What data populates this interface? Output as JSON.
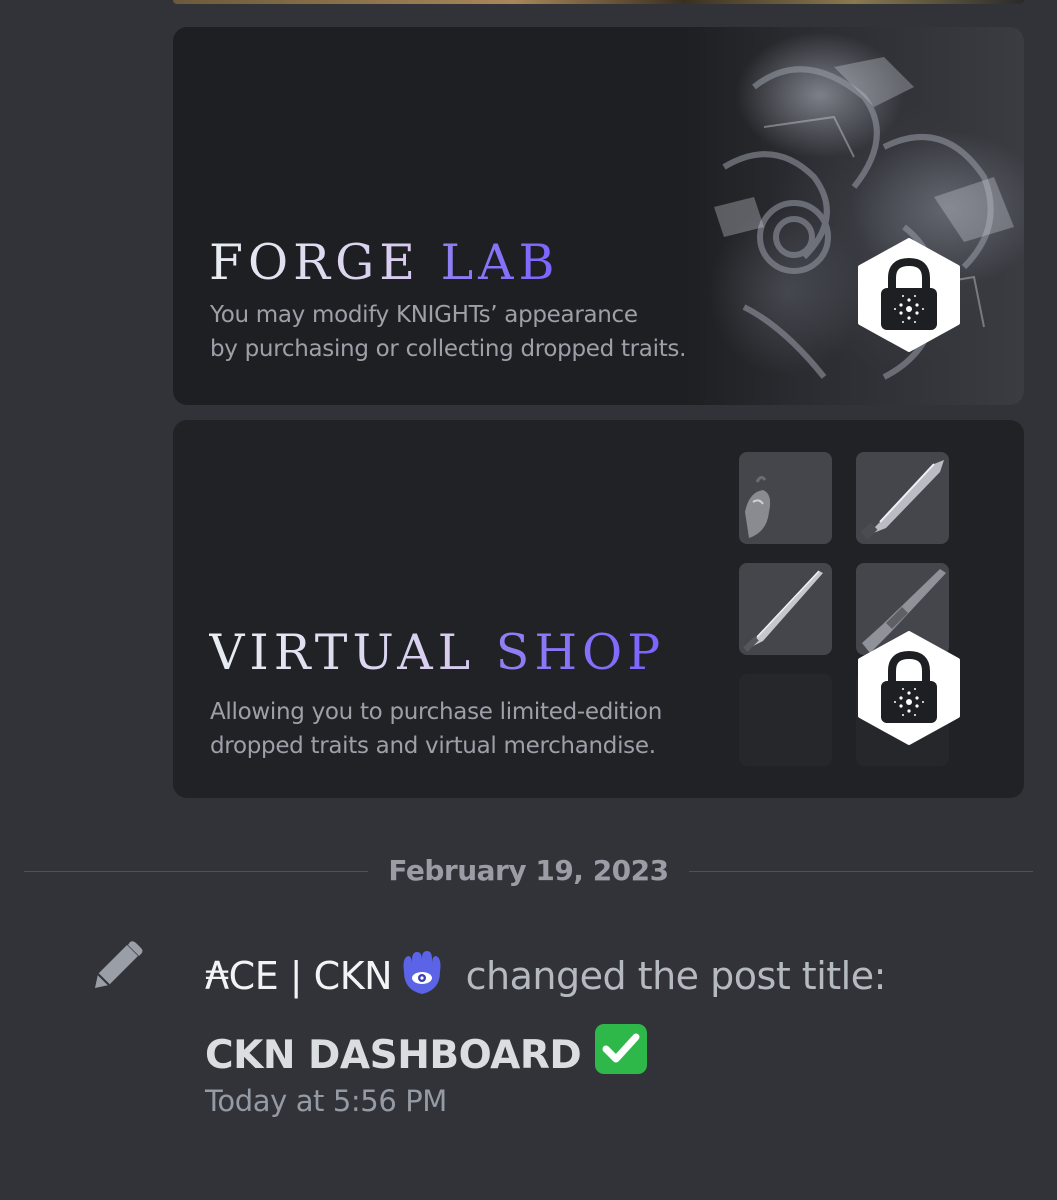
{
  "cards": [
    {
      "title_part1": "FORGE",
      "title_part2": "LAB",
      "description_line1": "You may modify KNIGHTs’ appearance",
      "description_line2": "by purchasing or collecting dropped traits.",
      "locked": true
    },
    {
      "title_part1": "VIRTUAL",
      "title_part2": "SHOP",
      "description_line1": "Allowing you to purchase limited-edition",
      "description_line2": "dropped traits and virtual merchandise.",
      "locked": true
    }
  ],
  "date_divider": "February 19, 2023",
  "system_message": {
    "icon": "pencil-icon",
    "username": "₳CE | CKN",
    "username_emoji": "hamsa-icon",
    "action_text": "changed the post title:",
    "new_title": "CKN DASHBOARD",
    "title_emoji": "check-mark-button-icon",
    "timestamp": "Today at 5:56 PM"
  },
  "colors": {
    "background": "#313338",
    "card_background": "#1e1f22",
    "title_accent": "#7b62ff",
    "check_green": "#2fb84a"
  }
}
